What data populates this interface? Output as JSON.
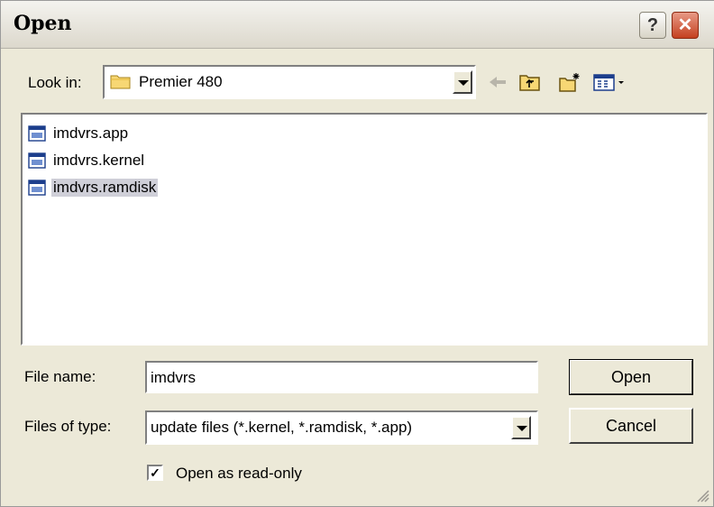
{
  "window": {
    "title": "Open",
    "help_label": "?",
    "close_label": "✕"
  },
  "lookin": {
    "label": "Look in:",
    "value": "Premier 480"
  },
  "toolbar": {
    "back_icon": "back-arrow-icon",
    "up_icon": "up-folder-icon",
    "new_folder_icon": "new-folder-icon",
    "view_menu_icon": "view-menu-icon"
  },
  "files": [
    {
      "name": "imdvrs.app",
      "selected": false
    },
    {
      "name": "imdvrs.kernel",
      "selected": false
    },
    {
      "name": "imdvrs.ramdisk",
      "selected": true
    }
  ],
  "filename": {
    "label": "File name:",
    "value": "imdvrs"
  },
  "filetype": {
    "label": "Files of type:",
    "value": "update files (*.kernel, *.ramdisk, *.app)"
  },
  "buttons": {
    "open": "Open",
    "cancel": "Cancel"
  },
  "readonly": {
    "label": "Open as read-only",
    "checked": true,
    "mark": "✓"
  }
}
